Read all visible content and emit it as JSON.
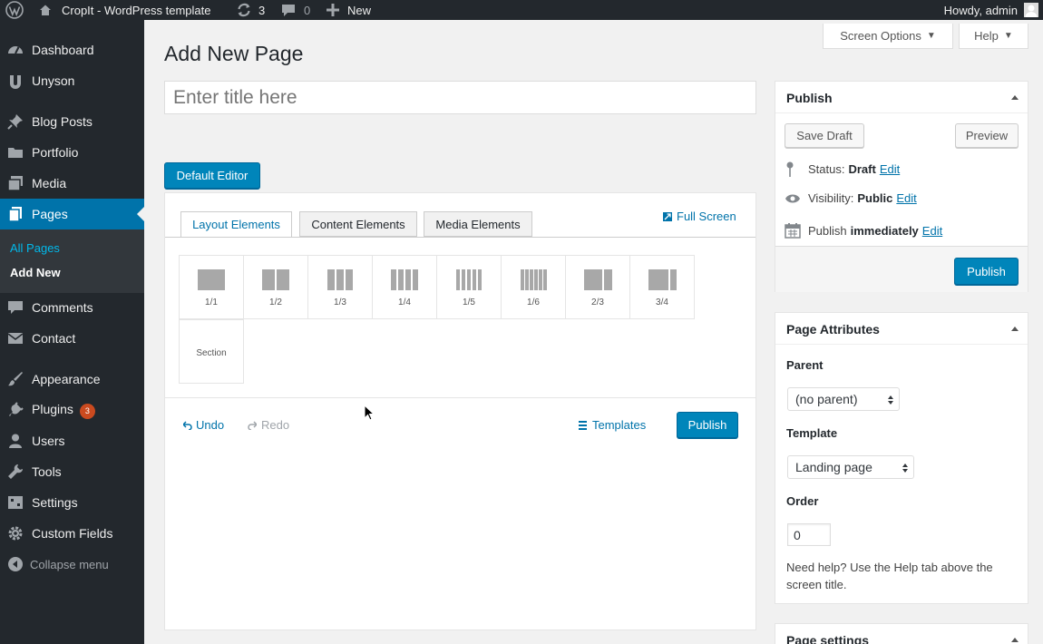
{
  "adminbar": {
    "site_name": "CropIt - WordPress template",
    "updates_count": "3",
    "comments_count": "0",
    "new_label": "New",
    "howdy": "Howdy, admin"
  },
  "sidebar": {
    "items": [
      {
        "label": "Dashboard",
        "icon": "dashboard-icon"
      },
      {
        "label": "Unyson",
        "icon": "unyson-icon"
      },
      {
        "label": "Blog Posts",
        "icon": "pin-icon"
      },
      {
        "label": "Portfolio",
        "icon": "portfolio-icon"
      },
      {
        "label": "Media",
        "icon": "media-icon"
      },
      {
        "label": "Pages",
        "icon": "pages-icon"
      },
      {
        "label": "Comments",
        "icon": "comment-icon"
      },
      {
        "label": "Contact",
        "icon": "mail-icon"
      },
      {
        "label": "Appearance",
        "icon": "brush-icon"
      },
      {
        "label": "Plugins",
        "icon": "plugin-icon",
        "badge": "3"
      },
      {
        "label": "Users",
        "icon": "user-icon"
      },
      {
        "label": "Tools",
        "icon": "wrench-icon"
      },
      {
        "label": "Settings",
        "icon": "settings-icon"
      },
      {
        "label": "Custom Fields",
        "icon": "gear-icon"
      }
    ],
    "submenu": [
      "All Pages",
      "Add New"
    ],
    "collapse_label": "Collapse menu"
  },
  "header": {
    "screen_options": "Screen Options",
    "help": "Help",
    "page_title": "Add New Page"
  },
  "editor": {
    "title_placeholder": "Enter title here",
    "default_editor_button": "Default Editor",
    "tabs": [
      "Layout Elements",
      "Content Elements",
      "Media Elements"
    ],
    "full_screen": "Full Screen",
    "layout_items": [
      "1/1",
      "1/2",
      "1/3",
      "1/4",
      "1/5",
      "1/6",
      "2/3",
      "3/4"
    ],
    "section_label": "Section",
    "undo": "Undo",
    "redo": "Redo",
    "templates": "Templates",
    "publish": "Publish"
  },
  "publish_box": {
    "title": "Publish",
    "save_draft": "Save Draft",
    "preview": "Preview",
    "status_label": "Status:",
    "status_value": "Draft",
    "visibility_label": "Visibility:",
    "visibility_value": "Public",
    "publish_label": "Publish",
    "publish_value": "immediately",
    "edit": "Edit",
    "publish_button": "Publish"
  },
  "page_attributes": {
    "title": "Page Attributes",
    "parent_label": "Parent",
    "parent_value": "(no parent)",
    "template_label": "Template",
    "template_value": "Landing page",
    "order_label": "Order",
    "order_value": "0",
    "help_text": "Need help? Use the Help tab above the screen title."
  },
  "page_settings": {
    "title": "Page settings"
  },
  "colors": {
    "admin_dark": "#23282d",
    "accent_blue": "#0073aa",
    "button_blue": "#0085ba",
    "badge_orange": "#ca4a1f"
  }
}
